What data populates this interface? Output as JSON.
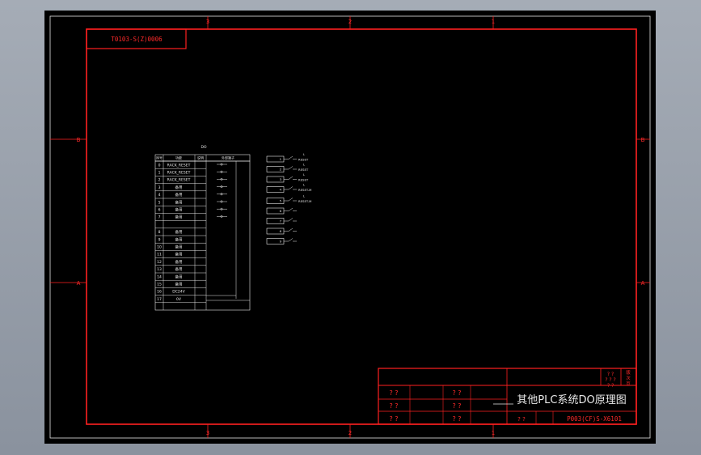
{
  "drawing": {
    "code_tab": "T0103-S(Z)0006",
    "drawing_number": "P003(CF)S-X6101",
    "title": "其他PLC系统DO原理图",
    "zone_cols": [
      "3",
      "2",
      "1"
    ],
    "zone_rows": [
      "B",
      "A"
    ],
    "unknown_mark": "? ?",
    "block_marks": [
      "? ?",
      "? ?",
      "? ?"
    ],
    "block_marks_right": [
      "? ?",
      "? ?",
      "? ?"
    ],
    "corner_labels": [
      "? ?",
      "? ? ?",
      "? ?"
    ],
    "corner_side": [
      "版",
      "次",
      "页"
    ]
  },
  "io_table": {
    "title": "DO",
    "headers": [
      "序号",
      "功能",
      "说明",
      "外部端子"
    ],
    "rows": [
      {
        "no": "0",
        "name": "RACK_RESET"
      },
      {
        "no": "1",
        "name": "RACK_RESET"
      },
      {
        "no": "2",
        "name": "RACK_RESET"
      },
      {
        "no": "3",
        "name": "备用"
      },
      {
        "no": "4",
        "name": "备用"
      },
      {
        "no": "5",
        "name": "备用"
      },
      {
        "no": "6",
        "name": "备用"
      },
      {
        "no": "7",
        "name": "备用"
      },
      {
        "no": "",
        "name": ""
      },
      {
        "no": "8",
        "name": "备用"
      },
      {
        "no": "9",
        "name": "备用"
      },
      {
        "no": "10",
        "name": "备用"
      },
      {
        "no": "11",
        "name": "备用"
      },
      {
        "no": "12",
        "name": "备用"
      },
      {
        "no": "13",
        "name": "备用"
      },
      {
        "no": "14",
        "name": "备用"
      },
      {
        "no": "15",
        "name": "备用"
      },
      {
        "no": "16",
        "name": "DC24V"
      },
      {
        "no": "17",
        "name": "0V"
      },
      {
        "no": "",
        "name": ""
      }
    ]
  },
  "relays": [
    {
      "label": "1",
      "out": "L",
      "tag": "RESET"
    },
    {
      "label": "2",
      "out": "L",
      "tag": "RESET"
    },
    {
      "label": "3",
      "out": "L",
      "tag": "RESET"
    },
    {
      "label": "4",
      "out": "L",
      "tag": "RESET-M"
    },
    {
      "label": "5",
      "out": "L",
      "tag": "RESET-M"
    },
    {
      "label": "6",
      "out": "",
      "tag": ""
    },
    {
      "label": "7",
      "out": "",
      "tag": ""
    },
    {
      "label": "8",
      "out": "",
      "tag": ""
    },
    {
      "label": "9",
      "out": "",
      "tag": ""
    }
  ]
}
